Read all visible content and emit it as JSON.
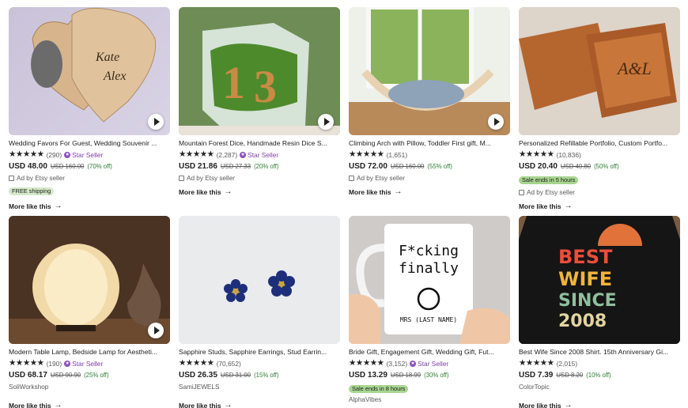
{
  "listings": [
    {
      "title": "Wedding Favors For Guest, Wedding Souvenir ...",
      "rating_count": "(290)",
      "star_seller": "Star Seller",
      "price": "USD 48.00",
      "original_price": "USD 160.00",
      "discount": "(70% off)",
      "shop_line": "Ad by Etsy seller",
      "tag": "FREE shipping",
      "more": "More like this",
      "video": true,
      "image": "heart-shaped-wood-box-icon"
    },
    {
      "title": "Mountain Forest Dice, Handmade Resin Dice S...",
      "rating_count": "(2,287)",
      "star_seller": "Star Seller",
      "price": "USD 21.86",
      "original_price": "USD 27.33",
      "discount": "(20% off)",
      "shop_line": "Ad by Etsy seller",
      "tag": "",
      "more": "More like this",
      "video": true,
      "image": "resin-dice-icon"
    },
    {
      "title": "Climbing Arch with Pillow, Toddler First gift, M...",
      "rating_count": "(1,651)",
      "star_seller": "",
      "price": "USD 72.00",
      "original_price": "USD 160.00",
      "discount": "(55% off)",
      "shop_line": "Ad by Etsy seller",
      "tag": "",
      "more": "More like this",
      "video": true,
      "image": "climbing-arch-icon"
    },
    {
      "title": "Personalized Refillable Portfolio, Custom Portfo...",
      "rating_count": "(10,836)",
      "star_seller": "",
      "price": "USD 20.40",
      "original_price": "USD 40.80",
      "discount": "(50% off)",
      "shop_line": "Ad by Etsy seller",
      "tag": "Sale ends in 5 hours",
      "more": "More like this",
      "video": false,
      "image": "leather-portfolio-icon"
    },
    {
      "title": "Modern Table Lamp, Bedside Lamp for Aestheti...",
      "rating_count": "(190)",
      "star_seller": "Star Seller",
      "price": "USD 68.17",
      "original_price": "USD 90.90",
      "discount": "(25% off)",
      "shop_line": "SoliWorkshop",
      "tag": "",
      "more": "More like this",
      "video": true,
      "image": "table-lamp-icon"
    },
    {
      "title": "Sapphire Studs, Sapphire Earrings, Stud Earrin...",
      "rating_count": "(70,652)",
      "star_seller": "",
      "price": "USD 26.35",
      "original_price": "USD 31.00",
      "discount": "(15% off)",
      "shop_line": "SamiJEWELS",
      "tag": "",
      "more": "More like this",
      "video": false,
      "image": "sapphire-earrings-icon"
    },
    {
      "title": "Bride Gift, Engagement Gift, Wedding Gift, Fut...",
      "rating_count": "(3,152)",
      "star_seller": "Star Seller",
      "price": "USD 13.29",
      "original_price": "USD 18.99",
      "discount": "(30% off)",
      "shop_line": "AlphaVibes",
      "tag": "Sale ends in 8 hours",
      "more": "",
      "video": false,
      "image": "mug-icon",
      "mug_lines": [
        "F*cking",
        "finally",
        "MRS (LAST NAME)"
      ]
    },
    {
      "title": "Best Wife Since 2008 Shirt. 15th Anniversary Gi...",
      "rating_count": "(2,015)",
      "star_seller": "",
      "price": "USD 7.39",
      "original_price": "USD 8.20",
      "discount": "(10% off)",
      "shop_line": "ColorTopic",
      "tag": "",
      "more": "More like this",
      "video": false,
      "image": "tshirt-icon",
      "shirt_lines": [
        "BEST",
        "WIFE",
        "SINCE",
        "2008"
      ]
    }
  ],
  "stars": "★★★★★",
  "colors": {
    "star_seller": "#7f3ea6",
    "discount": "#2e7d32",
    "sale_tag": "#a7d58f",
    "free_tag": "#d4e9c9"
  }
}
